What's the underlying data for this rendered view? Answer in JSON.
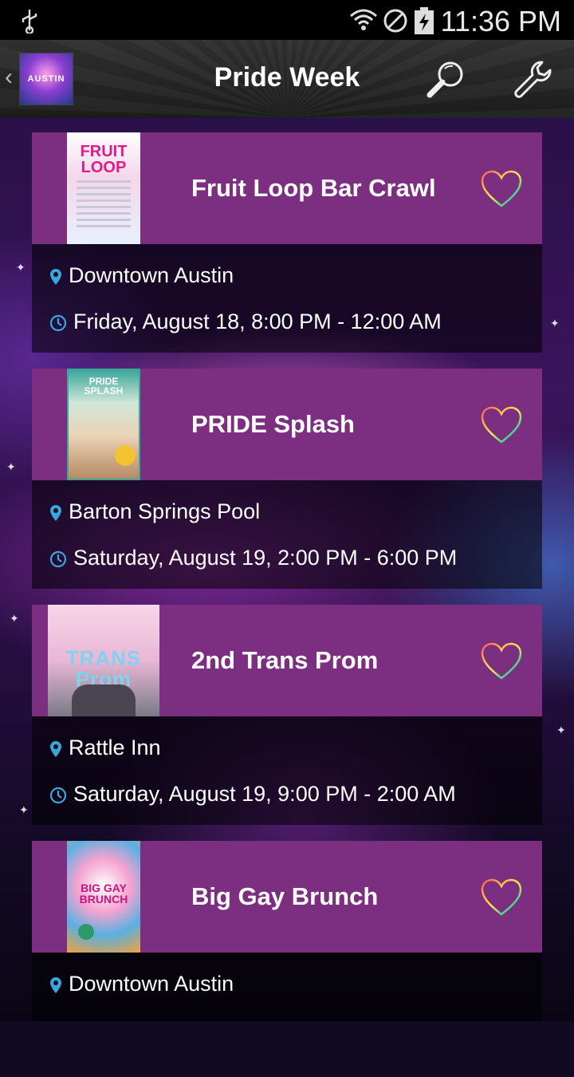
{
  "status_bar": {
    "time": "11:36 PM"
  },
  "action_bar": {
    "title": "Pride Week",
    "logo_text": "AUSTIN"
  },
  "events": [
    {
      "title": "Fruit Loop Bar Crawl",
      "location": "Downtown Austin",
      "datetime": "Friday, August 18, 8:00 PM - 12:00 AM",
      "poster_text": "FRUIT LOOP"
    },
    {
      "title": "PRIDE Splash",
      "location": "Barton Springs Pool",
      "datetime": "Saturday, August 19, 2:00 PM - 6:00 PM",
      "poster_text": "PRIDE SPLASH"
    },
    {
      "title": "2nd Trans Prom",
      "location": "Rattle Inn",
      "datetime": "Saturday, August 19, 9:00 PM - 2:00 AM",
      "poster_text": "TRANS Prom"
    },
    {
      "title": "Big Gay Brunch",
      "location": "Downtown Austin",
      "datetime": "",
      "poster_text": "BIG GAY BRUNCH"
    }
  ],
  "colors": {
    "card_header": "#7c2e80",
    "accent_icon": "#3aa6e0"
  },
  "icons": {
    "location": "map-pin-icon",
    "time": "clock-icon",
    "favorite": "heart-icon",
    "search": "search-icon",
    "settings": "wrench-icon"
  }
}
